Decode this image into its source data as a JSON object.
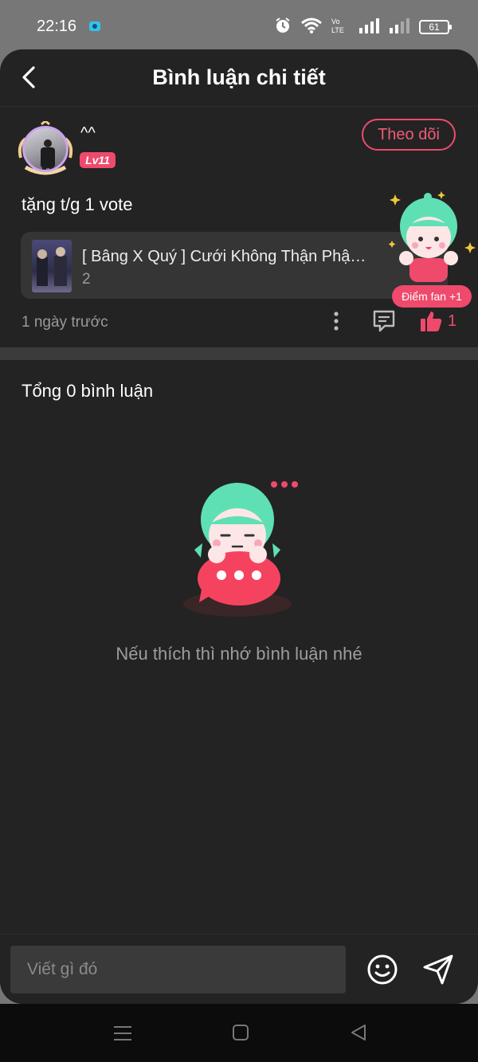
{
  "status_bar": {
    "time": "22:16",
    "battery": "61",
    "icons": [
      "app-notification-icon",
      "alarm-icon",
      "wifi-icon",
      "volte-icon",
      "signal-icon",
      "signal-icon",
      "battery-icon"
    ]
  },
  "header": {
    "title": "Bình luận chi tiết",
    "back_icon": "chevron-left-icon"
  },
  "post": {
    "username": "^^",
    "level": "Lv11",
    "follow_label": "Theo dõi",
    "text": "tặng t/g 1 vote",
    "story": {
      "title": "[ Bâng X Quý ] Cưới Không Thận Phậ…",
      "count": "2"
    },
    "fan_badge": "Điểm fan +1",
    "time_ago": "1 ngày trước",
    "like_count": "1",
    "action_icons": [
      "more-vertical-icon",
      "comment-icon",
      "thumbs-up-icon"
    ]
  },
  "comments": {
    "total_label": "Tổng 0 bình luận",
    "empty_message": "Nếu thích thì nhớ bình luận nhé"
  },
  "composer": {
    "placeholder": "Viết gì đó",
    "icons": [
      "emoji-icon",
      "send-icon"
    ]
  },
  "nav_bar": {
    "icons": [
      "menu-icon",
      "home-square-icon",
      "back-triangle-icon"
    ]
  },
  "colors": {
    "accent": "#ef4a6c",
    "background": "#232323",
    "card": "#353535",
    "mascot_hair": "#5fe0b4"
  }
}
